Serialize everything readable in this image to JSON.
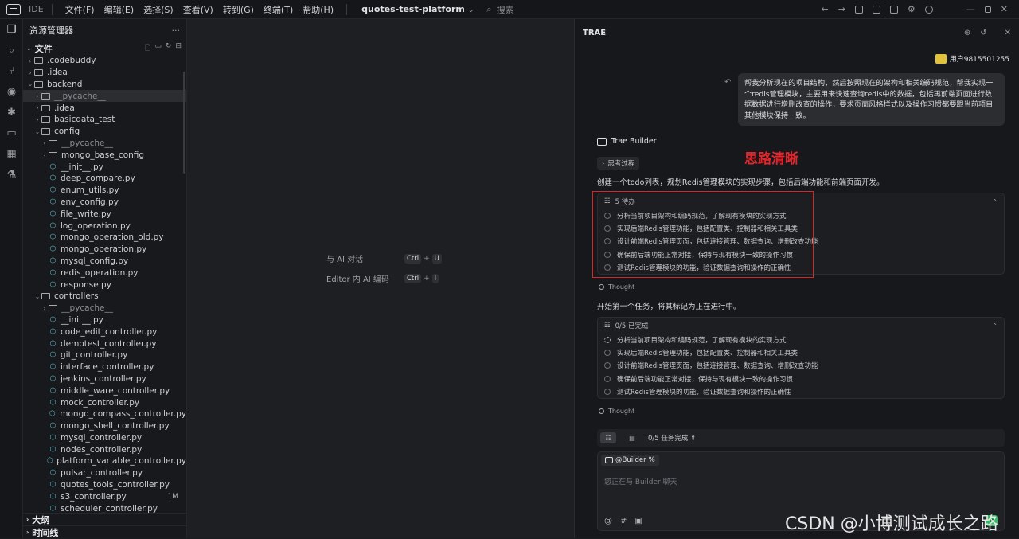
{
  "titlebar": {
    "ide_label": "IDE",
    "menu": [
      "文件(F)",
      "编辑(E)",
      "选择(S)",
      "查看(V)",
      "转到(G)",
      "终端(T)",
      "帮助(H)"
    ],
    "project": "quotes-test-platform",
    "search_placeholder": "搜索"
  },
  "explorer": {
    "title": "资源管理器",
    "section_files": "文件",
    "tree": [
      {
        "name": ".codebuddy",
        "type": "folder",
        "depth": 0,
        "expanded": false
      },
      {
        "name": ".idea",
        "type": "folder",
        "depth": 0,
        "expanded": false
      },
      {
        "name": "backend",
        "type": "folder",
        "depth": 0,
        "expanded": true
      },
      {
        "name": "__pycache__",
        "type": "folder",
        "depth": 1,
        "expanded": false,
        "dim": true,
        "selected": true
      },
      {
        "name": ".idea",
        "type": "folder",
        "depth": 1,
        "expanded": false
      },
      {
        "name": "basicdata_test",
        "type": "folder",
        "depth": 1,
        "expanded": false
      },
      {
        "name": "config",
        "type": "folder",
        "depth": 1,
        "expanded": true
      },
      {
        "name": "__pycache__",
        "type": "folder",
        "depth": 2,
        "expanded": false,
        "dim": true
      },
      {
        "name": "mongo_base_config",
        "type": "folder",
        "depth": 2,
        "expanded": false
      },
      {
        "name": "__init__.py",
        "type": "py",
        "depth": 2
      },
      {
        "name": "deep_compare.py",
        "type": "py",
        "depth": 2
      },
      {
        "name": "enum_utils.py",
        "type": "py",
        "depth": 2
      },
      {
        "name": "env_config.py",
        "type": "py",
        "depth": 2
      },
      {
        "name": "file_write.py",
        "type": "py",
        "depth": 2
      },
      {
        "name": "log_operation.py",
        "type": "py",
        "depth": 2
      },
      {
        "name": "mongo_operation_old.py",
        "type": "py",
        "depth": 2
      },
      {
        "name": "mongo_operation.py",
        "type": "py",
        "depth": 2
      },
      {
        "name": "mysql_config.py",
        "type": "py",
        "depth": 2
      },
      {
        "name": "redis_operation.py",
        "type": "py",
        "depth": 2
      },
      {
        "name": "response.py",
        "type": "py",
        "depth": 2
      },
      {
        "name": "controllers",
        "type": "folder",
        "depth": 1,
        "expanded": true
      },
      {
        "name": "__pycache__",
        "type": "folder",
        "depth": 2,
        "expanded": false,
        "dim": true
      },
      {
        "name": "__init__.py",
        "type": "py",
        "depth": 2
      },
      {
        "name": "code_edit_controller.py",
        "type": "py",
        "depth": 2
      },
      {
        "name": "demotest_controller.py",
        "type": "py",
        "depth": 2
      },
      {
        "name": "git_controller.py",
        "type": "py",
        "depth": 2
      },
      {
        "name": "interface_controller.py",
        "type": "py",
        "depth": 2
      },
      {
        "name": "jenkins_controller.py",
        "type": "py",
        "depth": 2
      },
      {
        "name": "middle_ware_controller.py",
        "type": "py",
        "depth": 2
      },
      {
        "name": "mock_controller.py",
        "type": "py",
        "depth": 2
      },
      {
        "name": "mongo_compass_controller.py",
        "type": "py",
        "depth": 2
      },
      {
        "name": "mongo_shell_controller.py",
        "type": "py",
        "depth": 2
      },
      {
        "name": "mysql_controller.py",
        "type": "py",
        "depth": 2
      },
      {
        "name": "nodes_controller.py",
        "type": "py",
        "depth": 2
      },
      {
        "name": "platform_variable_controller.py",
        "type": "py",
        "depth": 2
      },
      {
        "name": "pulsar_controller.py",
        "type": "py",
        "depth": 2
      },
      {
        "name": "quotes_tools_controller.py",
        "type": "py",
        "depth": 2
      },
      {
        "name": "s3_controller.py",
        "type": "py",
        "depth": 2,
        "badge": "1M"
      },
      {
        "name": "scheduler_controller.py",
        "type": "py",
        "depth": 2
      }
    ],
    "section_outline": "大纲",
    "section_timeline": "时间线"
  },
  "editor": {
    "hints": [
      {
        "label": "与 AI 对话",
        "key1": "Ctrl",
        "key2": "U"
      },
      {
        "label": "Editor 内 AI 编码",
        "key1": "Ctrl",
        "key2": "I"
      }
    ]
  },
  "chat": {
    "title": "TRAE",
    "user_name": "用户9815501255",
    "user_message": "帮我分析现在的项目结构，然后按照现在的架构和相关编码规范，帮我实现一个redis管理模块，主要用来快速查询redis中的数据，包括再前端页面进行数据数据进行增删改查的操作，要求页面风格样式以及操作习惯都要跟当前项目其他模块保持一致。",
    "bot_name": "Trae Builder",
    "annotation": "思路清晰",
    "think_chip": "思考过程",
    "para1": "创建一个todo列表，规划Redis管理模块的实现步骤，包括后端功能和前端页面开发。",
    "todo1": {
      "header": "5 待办",
      "items": [
        "分析当前项目架构和编码规范，了解现有模块的实现方式",
        "实现后端Redis管理功能，包括配置类、控制器和相关工具类",
        "设计前端Redis管理页面，包括连接管理、数据查询、增删改查功能",
        "确保前后端功能正常对接，保持与现有模块一致的操作习惯",
        "测试Redis管理模块的功能，验证数据查询和操作的正确性"
      ]
    },
    "thought1": "Thought",
    "para2": "开始第一个任务，将其标记为正在进行中。",
    "todo2": {
      "header": "0/5 已完成",
      "items": [
        "分析当前项目架构和编码规范，了解现有模块的实现方式",
        "实现后端Redis管理功能，包括配置类、控制器和相关工具类",
        "设计前端Redis管理页面，包括连接管理、数据查询、增删改查功能",
        "确保前后端功能正常对接，保持与现有模块一致的操作习惯",
        "测试Redis管理模块的功能，验证数据查询和操作的正确性"
      ]
    },
    "thought2": "Thought",
    "task_status": "0/5 任务完成",
    "builder_tag": "@Builder",
    "input_placeholder": "您正在与 Builder 聊天",
    "watermark": "CSDN @小博测试成长之路"
  }
}
